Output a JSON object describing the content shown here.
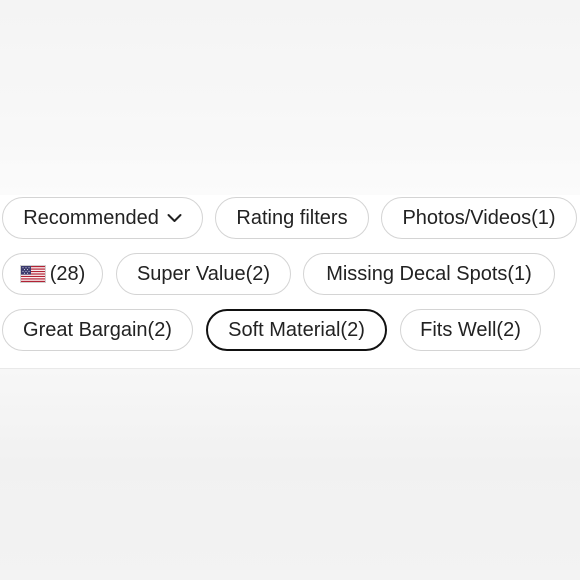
{
  "filters": {
    "sort": {
      "label": "Recommended",
      "icon": "chevron-down-icon"
    },
    "rating": {
      "label": "Rating filters"
    },
    "media": {
      "label": "Photos/Videos(1)"
    },
    "country": {
      "icon": "us-flag-icon",
      "label": "(28)"
    },
    "tags": [
      {
        "label": "Super Value(2)"
      },
      {
        "label": "Missing Decal Spots(1)"
      },
      {
        "label": "Great Bargain(2)"
      },
      {
        "label": "Soft Material(2)",
        "selected": true
      },
      {
        "label": "Fits Well(2)"
      }
    ]
  },
  "colors": {
    "chip_border": "#d4d4d4",
    "selected_border": "#111111",
    "text": "#222222"
  }
}
